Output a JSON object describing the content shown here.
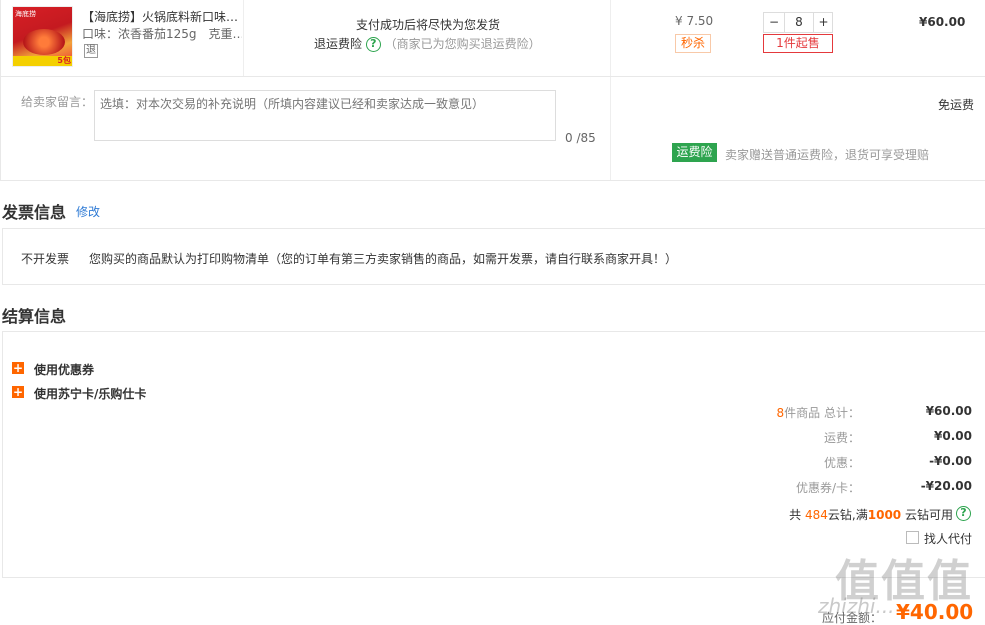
{
  "product": {
    "title": "【海底捞】火锅底料新口味…",
    "spec": "口味：浓香番茄125g　克重…",
    "return_badge": "退",
    "thumb_brand": "海底捞",
    "thumb_tag": "5包",
    "ship_note": "支付成功后将尽快为您发货",
    "insurance_label": "退运费险",
    "insurance_note": "（商家已为您购买退运费险）",
    "unit_price": "¥ 7.50",
    "flash_tag": "秒杀",
    "qty_minus": "−",
    "qty_value": "8",
    "qty_plus": "+",
    "min_order": "1件起售",
    "subtotal": "¥60.00"
  },
  "message": {
    "label": "给卖家留言：",
    "placeholder": "选填：对本次交易的补充说明（所填内容建议已经和卖家达成一致意见）",
    "counter": "0 /85",
    "shipping": "免运费",
    "insurance_badge": "运费险",
    "insurance_text": "卖家赠送普通运费险，退货可享受理赔"
  },
  "invoice": {
    "title": "发票信息",
    "edit": "修改",
    "type": "不开发票",
    "note": "您购买的商品默认为打印购物清单（您的订单有第三方卖家销售的商品，如需开发票，请自行联系商家开具！）"
  },
  "settlement": {
    "title": "结算信息",
    "coupon_label": "使用优惠券",
    "card_label": "使用苏宁卡/乐购仕卡",
    "plus_icon": "+",
    "count_num": "8",
    "count_text": "件商品 总计：",
    "total": "¥60.00",
    "freight_label": "运费：",
    "freight": "¥0.00",
    "discount_label": "优惠：",
    "discount": "-¥0.00",
    "coupon_card_label": "优惠券/卡：",
    "coupon_card": "-¥20.00",
    "cloud_pre": "共",
    "cloud_num": "484",
    "cloud_mid": "云钻,满",
    "cloud_threshold": "1000",
    "cloud_post": "云钻可用",
    "proxy_label": "找人代付",
    "payable_label": "应付金额：",
    "payable": "¥40.00"
  },
  "watermark": {
    "logo": "值值值",
    "site": "zhizhi..."
  },
  "colors": {
    "accent_orange": "#ff6600",
    "accent_red": "#e4393c",
    "insurance_green": "#2ea44f",
    "link_blue": "#2f7bd5"
  }
}
